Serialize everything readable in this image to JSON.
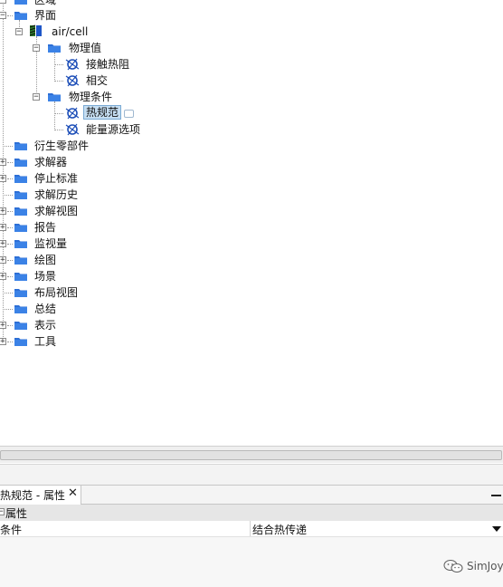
{
  "tree": {
    "region": "区域",
    "interface": "界面",
    "air_cell": "air/cell",
    "physics_values": "物理值",
    "contact_resistance": "接触热阻",
    "intersect": "相交",
    "physics_conditions": "物理条件",
    "thermal_spec": "热规范",
    "energy_source_option": "能量源选项",
    "derived_parts": "衍生零部件",
    "solvers": "求解器",
    "stopping_criteria": "停止标准",
    "solution_history": "求解历史",
    "solution_views": "求解视图",
    "reports": "报告",
    "monitors": "监视量",
    "plots": "绘图",
    "scenes": "场景",
    "layout_views": "布局视图",
    "summary": "总结",
    "representations": "表示",
    "tools": "工具"
  },
  "properties": {
    "tab_title": "热规范 - 属性",
    "section": "属性",
    "row_key": "条件",
    "row_value": "结合热传递"
  },
  "watermark": "SimJoy",
  "colors": {
    "folder": "#2d6fd6",
    "selection": "#c6def2"
  }
}
